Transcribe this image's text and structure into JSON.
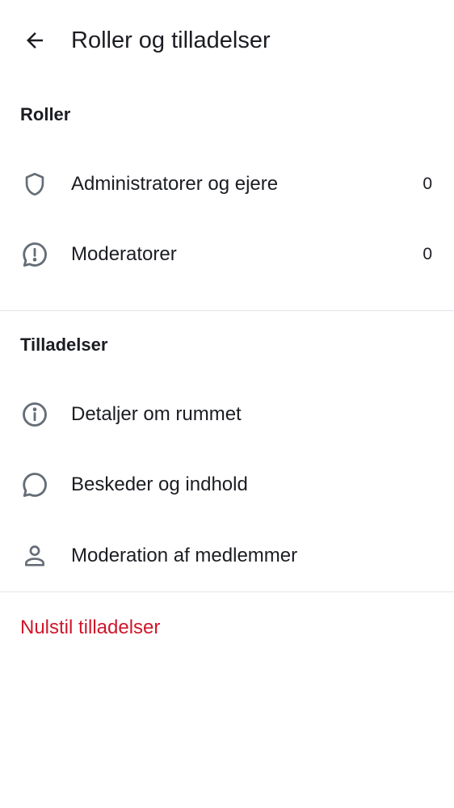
{
  "app_bar": {
    "title": "Roller og tilladelser",
    "back_icon": "arrow-left-icon"
  },
  "roles_section": {
    "heading": "Roller",
    "items": [
      {
        "label": "Administratorer og ejere",
        "count": "0",
        "icon": "shield-icon"
      },
      {
        "label": "Moderatorer",
        "count": "0",
        "icon": "chat-alert-icon"
      }
    ]
  },
  "permissions_section": {
    "heading": "Tilladelser",
    "items": [
      {
        "label": "Detaljer om rummet",
        "icon": "info-icon"
      },
      {
        "label": "Beskeder og indhold",
        "icon": "chat-bubble-icon"
      },
      {
        "label": "Moderation af medlemmer",
        "icon": "user-icon"
      }
    ]
  },
  "reset": {
    "label": "Nulstil tilladelser"
  },
  "colors": {
    "text": "#1b1d22",
    "icon": "#656d77",
    "divider": "#e3e5e8",
    "danger": "#d0162a",
    "background": "#ffffff"
  }
}
